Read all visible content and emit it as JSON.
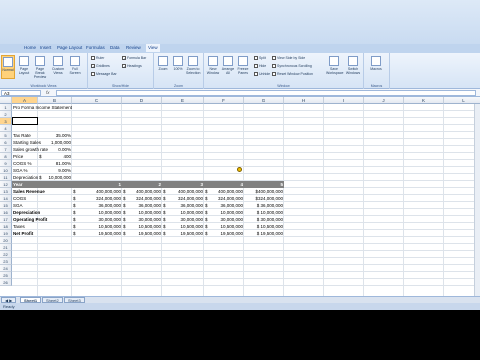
{
  "ribbon": {
    "tabs": [
      "Home",
      "Insert",
      "Page Layout",
      "Formulas",
      "Data",
      "Review",
      "View"
    ],
    "active_tab": "View",
    "groups": [
      "Workbook Views",
      "Show/Hide",
      "Zoom",
      "Window",
      "Macros"
    ],
    "buttons": {
      "normal": "Normal",
      "page_layout": "Page Layout",
      "page_break": "Page Break Preview",
      "custom_views": "Custom Views",
      "full_screen": "Full Screen",
      "zoom": "Zoom",
      "zoom100": "100%",
      "zoom_sel": "Zoom to Selection",
      "new_window": "New Window",
      "arrange_all": "Arrange All",
      "freeze_panes": "Freeze Panes",
      "save_ws": "Save Workspace",
      "switch_windows": "Switch Windows",
      "macros": "Macros"
    },
    "checks": {
      "ruler": "Ruler",
      "gridlines": "Gridlines",
      "message_bar": "Message Bar",
      "formula_bar": "Formula Bar",
      "headings": "Headings",
      "split": "Split",
      "hide": "Hide",
      "unhide": "Unhide",
      "side_by_side": "View Side by Side",
      "sync_scroll": "Synchronous Scrolling",
      "reset_pos": "Reset Window Position"
    }
  },
  "formula_bar": {
    "namebox": "A3",
    "fx": "fx"
  },
  "columns": [
    "A",
    "B",
    "C",
    "D",
    "E",
    "F",
    "G",
    "H",
    "I",
    "J",
    "K",
    "L",
    "M"
  ],
  "rows": [
    "1",
    "2",
    "3",
    "4",
    "5",
    "6",
    "7",
    "8",
    "9",
    "10",
    "11",
    "12",
    "13",
    "14",
    "15",
    "16",
    "17",
    "18",
    "19",
    "20",
    "21",
    "22",
    "23",
    "24",
    "25",
    "26"
  ],
  "sheet": {
    "title": "Pro Forma Income Statement",
    "params": [
      {
        "label": "Tax Rate",
        "dollar": "",
        "value": "35.00%"
      },
      {
        "label": "Starting Sales",
        "dollar": "",
        "value": "1,000,000"
      },
      {
        "label": "Sales growth rate",
        "dollar": "",
        "value": "0.00%"
      },
      {
        "label": "Price",
        "dollar": "$",
        "value": "400"
      },
      {
        "label": "COGS %",
        "dollar": "",
        "value": "81.00%"
      },
      {
        "label": "SGA %",
        "dollar": "",
        "value": "9.00%"
      },
      {
        "label": "Depreciation",
        "dollar": "$",
        "value": "10,000,000"
      }
    ],
    "year_row": {
      "label": "Year",
      "values": [
        "1",
        "2",
        "3",
        "4",
        "5"
      ]
    },
    "lines": [
      {
        "label": "Sales Revenue",
        "bold": true,
        "values": [
          "400,000,000",
          "400,000,000",
          "400,000,000",
          "400,000,000",
          "$400,000,000"
        ]
      },
      {
        "label": "COGS",
        "bold": false,
        "values": [
          "324,000,000",
          "324,000,000",
          "324,000,000",
          "324,000,000",
          "$324,000,000"
        ]
      },
      {
        "label": "SGA",
        "bold": false,
        "values": [
          "36,000,000",
          "36,000,000",
          "36,000,000",
          "36,000,000",
          "$ 36,000,000"
        ]
      },
      {
        "label": "Depreciation",
        "bold": true,
        "values": [
          "10,000,000",
          "10,000,000",
          "10,000,000",
          "10,000,000",
          "$ 10,000,000"
        ]
      },
      {
        "label": "Operating Profit",
        "bold": true,
        "values": [
          "30,000,000",
          "30,000,000",
          "30,000,000",
          "30,000,000",
          "$ 30,000,000"
        ]
      },
      {
        "label": "Taxes",
        "bold": false,
        "values": [
          "10,500,000",
          "10,500,000",
          "10,500,000",
          "10,500,000",
          "$ 10,500,000"
        ]
      },
      {
        "label": "Net Profit",
        "bold": true,
        "values": [
          "19,500,000",
          "19,500,000",
          "19,500,000",
          "19,500,000",
          "$ 19,500,000"
        ]
      }
    ],
    "dollar_sign": "$"
  },
  "sheet_tabs": [
    "Sheet1",
    "Sheet2",
    "Sheet3"
  ],
  "active_sheet": "Sheet1",
  "status": "Ready"
}
